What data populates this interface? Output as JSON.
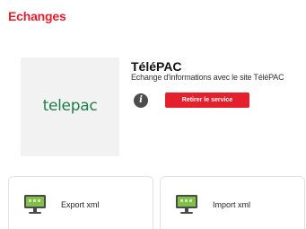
{
  "colors": {
    "accent": "#e4202d",
    "logo_green": "#1f7f4a",
    "icon_green": "#7fbf4a"
  },
  "page": {
    "title": "Echanges"
  },
  "service": {
    "logo_text": "telepac",
    "name": "TéléPAC",
    "description": "Echange d'informations avec le site TéléPAC",
    "info_icon": "info-icon",
    "remove_label": "Retirer le service"
  },
  "actions": [
    {
      "label": "Export xml",
      "icon": "computer-monitor-icon"
    },
    {
      "label": "Import xml",
      "icon": "computer-monitor-icon"
    }
  ]
}
